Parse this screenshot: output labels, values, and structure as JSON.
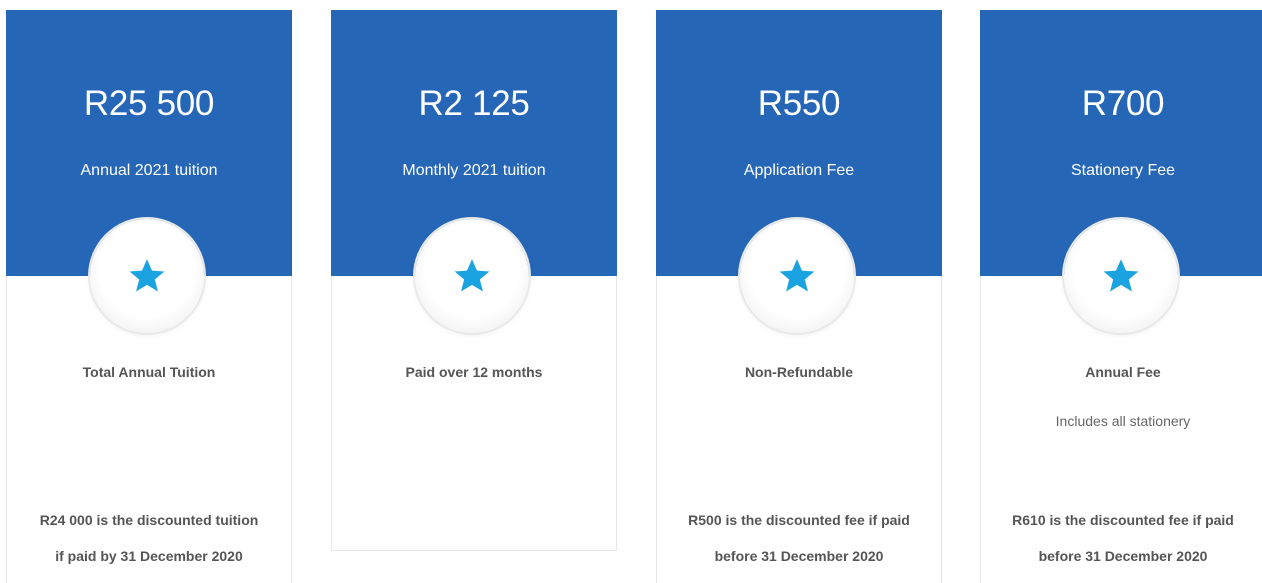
{
  "colors": {
    "header_blue": "#2666b7",
    "star_blue": "#1aa3e0",
    "text_gray": "#555555"
  },
  "cards": [
    {
      "price": "R25 500",
      "title": "Annual 2021 tuition",
      "icon": "star-icon",
      "feature": "Total Annual Tuition",
      "subnote": "",
      "note_line1": "R24 000 is the discounted tuition",
      "note_line2": "if paid by 31 December 2020"
    },
    {
      "price": "R2 125",
      "title": "Monthly 2021 tuition",
      "icon": "star-icon",
      "feature": "Paid over 12 months",
      "subnote": "",
      "note_line1": "",
      "note_line2": ""
    },
    {
      "price": "R550",
      "title": "Application Fee",
      "icon": "star-icon",
      "feature": "Non-Refundable",
      "subnote": "",
      "note_line1": "R500 is the discounted fee if paid",
      "note_line2": "before 31 December 2020"
    },
    {
      "price": "R700",
      "title": "Stationery Fee",
      "icon": "star-icon",
      "feature": "Annual Fee",
      "subnote": "Includes all stationery",
      "note_line1": "R610 is the discounted fee if paid",
      "note_line2": "before 31 December 2020"
    }
  ]
}
